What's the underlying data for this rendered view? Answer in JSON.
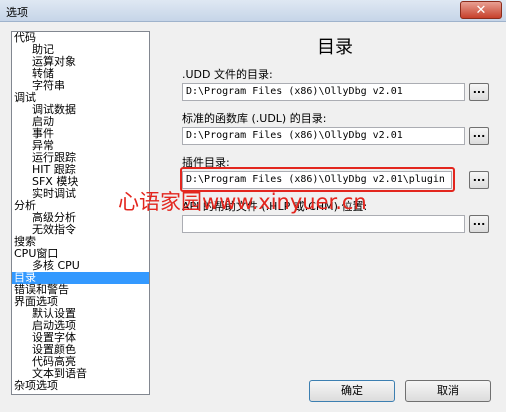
{
  "window": {
    "title": "选项",
    "close_label": "✕"
  },
  "tree": {
    "items": [
      {
        "label": "代码",
        "level": 0
      },
      {
        "label": "助记",
        "level": 1
      },
      {
        "label": "运算对象",
        "level": 1
      },
      {
        "label": "转储",
        "level": 1
      },
      {
        "label": "字符串",
        "level": 1
      },
      {
        "label": "调试",
        "level": 0
      },
      {
        "label": "调试数据",
        "level": 1
      },
      {
        "label": "启动",
        "level": 1
      },
      {
        "label": "事件",
        "level": 1
      },
      {
        "label": "异常",
        "level": 1
      },
      {
        "label": "运行跟踪",
        "level": 1
      },
      {
        "label": "HIT 跟踪",
        "level": 1
      },
      {
        "label": "SFX 模块",
        "level": 1
      },
      {
        "label": "实时调试",
        "level": 1
      },
      {
        "label": "分析",
        "level": 0
      },
      {
        "label": "高级分析",
        "level": 1
      },
      {
        "label": "无效指令",
        "level": 1
      },
      {
        "label": "搜索",
        "level": 0
      },
      {
        "label": "CPU窗口",
        "level": 0
      },
      {
        "label": "多核 CPU",
        "level": 1
      },
      {
        "label": "目录",
        "level": 0,
        "selected": true
      },
      {
        "label": "错误和警告",
        "level": 0
      },
      {
        "label": "界面选项",
        "level": 0
      },
      {
        "label": "默认设置",
        "level": 1
      },
      {
        "label": "启动选项",
        "level": 1
      },
      {
        "label": "设置字体",
        "level": 1
      },
      {
        "label": "设置颜色",
        "level": 1
      },
      {
        "label": "代码高亮",
        "level": 1
      },
      {
        "label": "文本到语音",
        "level": 1
      },
      {
        "label": "杂项选项",
        "level": 0
      }
    ]
  },
  "panel": {
    "title": "目录",
    "udd": {
      "label": ".UDD 文件的目录:",
      "value": "D:\\Program Files (x86)\\OllyDbg v2.01"
    },
    "udl": {
      "label": "标准的函数库 (.UDL) 的目录:",
      "value": "D:\\Program Files (x86)\\OllyDbg v2.01"
    },
    "plugin": {
      "label": "插件目录:",
      "value": "D:\\Program Files (x86)\\OllyDbg v2.01\\plugin"
    },
    "help": {
      "label": "API 的帮助文件 (.HLP 或.CHM) 位置:",
      "value": ""
    },
    "browse_label": "..."
  },
  "watermark": "心语家园www.xinyuer.cn",
  "buttons": {
    "ok": "确定",
    "cancel": "取消"
  },
  "colors": {
    "selection": "#3399ff",
    "highlight": "#e3261e"
  }
}
